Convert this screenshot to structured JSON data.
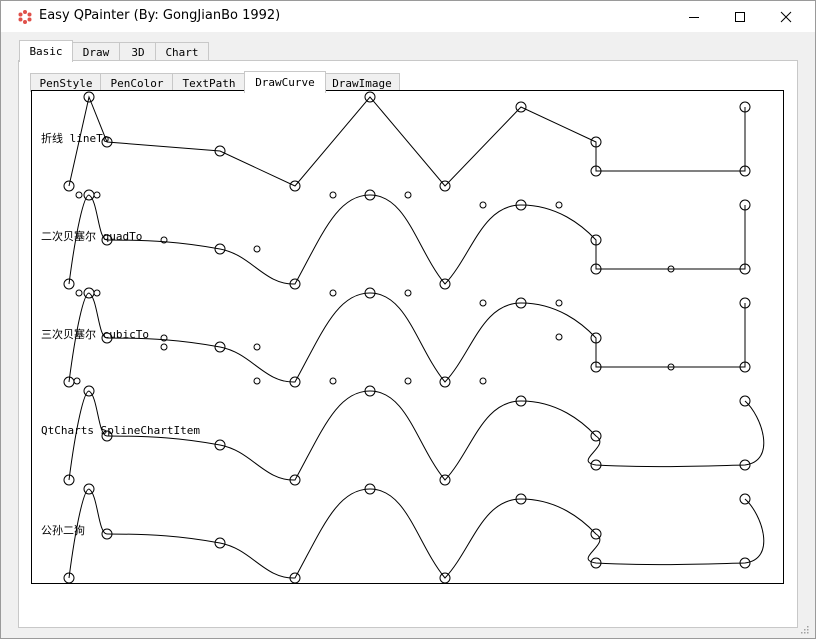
{
  "window": {
    "title": "Easy QPainter (By: GongJianBo 1992)",
    "icon": "app-logo-icon",
    "controls": [
      "minimize-icon",
      "maximize-icon",
      "close-icon"
    ]
  },
  "main_tabs": {
    "items": [
      "Basic",
      "Draw",
      "3D",
      "Chart"
    ],
    "selected": "Basic"
  },
  "sub_tabs": {
    "items": [
      "PenStyle",
      "PenColor",
      "TextPath",
      "DrawCurve",
      "DrawImage"
    ],
    "selected": "DrawCurve"
  },
  "canvas": {
    "rows": [
      {
        "label": "折线 lineTo"
      },
      {
        "label": "二次贝塞尔 quadTo"
      },
      {
        "label": "三次贝塞尔 cubicTo"
      },
      {
        "label": "QtCharts SplineChartItem"
      },
      {
        "label": "公孙二狗"
      }
    ]
  }
}
